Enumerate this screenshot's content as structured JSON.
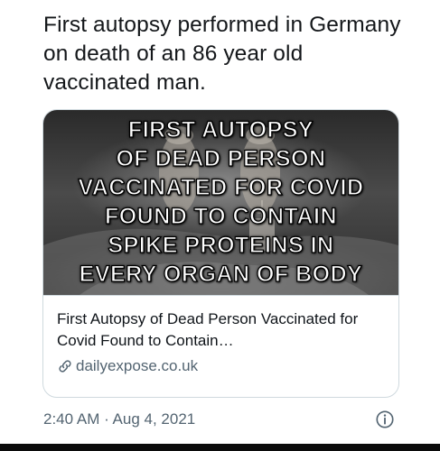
{
  "tweet": {
    "text": "First autopsy performed in Germany on death of an 86 year old vaccinated man."
  },
  "card": {
    "image_headline_lines": [
      "FIRST AUTOPSY",
      "OF DEAD PERSON",
      "VACCINATED FOR COVID",
      "FOUND TO CONTAIN",
      "SPIKE PROTEINS IN",
      "EVERY ORGAN OF BODY"
    ],
    "title": "First Autopsy of Dead Person Vaccinated for Covid Found to Contain…",
    "domain": "dailyexpose.co.uk",
    "link_icon": "link-icon"
  },
  "meta": {
    "timestamp": "2:40 AM · Aug 4, 2021",
    "info_icon": "info-icon"
  },
  "colors": {
    "text_primary": "#14171a",
    "text_secondary": "#536471",
    "card_border": "#cfd9de"
  }
}
